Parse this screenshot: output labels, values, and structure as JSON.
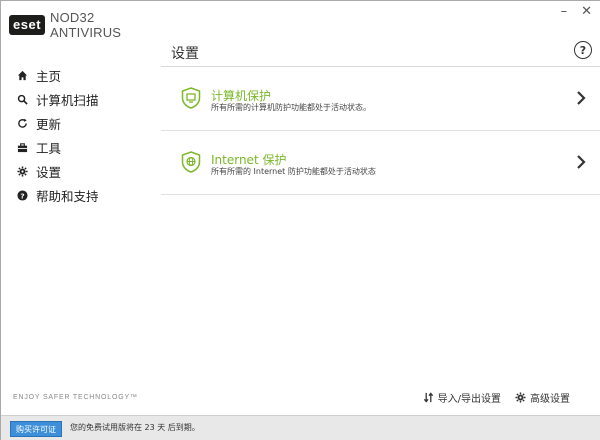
{
  "app": {
    "logo_text": "eset",
    "product_name": "NOD32 ANTIVIRUS",
    "tagline": "ENJOY SAFER TECHNOLOGY™"
  },
  "window_controls": {
    "minimize": "–",
    "close": "✕"
  },
  "sidebar": {
    "items": [
      {
        "label": "主页",
        "icon": "home-icon"
      },
      {
        "label": "计算机扫描",
        "icon": "search-icon"
      },
      {
        "label": "更新",
        "icon": "refresh-icon"
      },
      {
        "label": "工具",
        "icon": "toolbox-icon"
      },
      {
        "label": "设置",
        "icon": "gear-icon"
      },
      {
        "label": "帮助和支持",
        "icon": "help-icon"
      }
    ]
  },
  "main": {
    "title": "设置",
    "help_label": "?",
    "sections": [
      {
        "title": "计算机保护",
        "description": "所有所需的计算机防护功能都处于活动状态。",
        "icon": "shield-monitor-icon"
      },
      {
        "title": "Internet 保护",
        "description": "所有所需的 Internet 防护功能都处于活动状态",
        "icon": "shield-globe-icon"
      }
    ],
    "actions": {
      "import_export": "导入/导出设置",
      "advanced": "高级设置"
    }
  },
  "statusbar": {
    "buy_button": "购买许可证",
    "trial_text": "您的免费试用版将在 23 天 后到期。"
  },
  "colors": {
    "accent_green": "#7ab829",
    "buy_blue": "#3c8fd8",
    "logo_bg": "#1d1d1b"
  }
}
